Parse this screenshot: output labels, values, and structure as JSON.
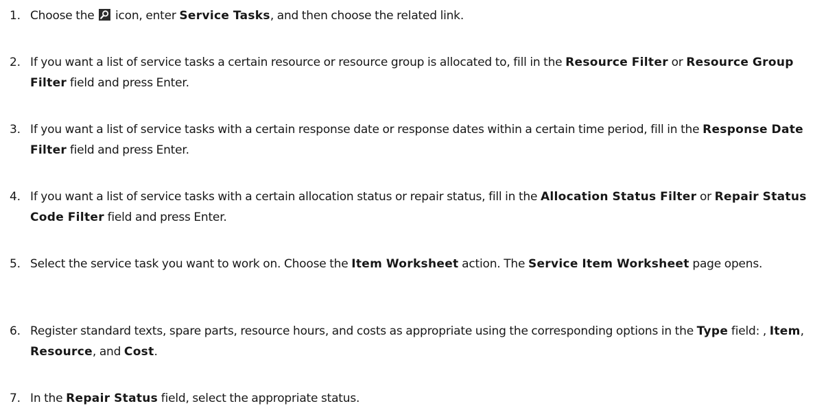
{
  "steps": [
    {
      "number": "1.",
      "parts": {
        "t1": "Choose the ",
        "t2": " icon, enter ",
        "b1": "Service Tasks",
        "t3": ", and then choose the related link."
      }
    },
    {
      "number": "2.",
      "parts": {
        "t1": "If you want a list of service tasks a certain resource or resource group is allocated to, fill in the ",
        "b1": "Resource Filter",
        "t2": " or ",
        "b2": "Resource Group Filter",
        "t3": " field and press Enter."
      }
    },
    {
      "number": "3.",
      "parts": {
        "t1": "If you want a list of service tasks with a certain response date or response dates within a certain time period, fill in the ",
        "b1": "Response Date Filter",
        "t2": " field and press Enter."
      }
    },
    {
      "number": "4.",
      "parts": {
        "t1": "If you want a list of service tasks with a certain allocation status or repair status, fill in the ",
        "b1": "Allocation Status Filter",
        "t2": " or ",
        "b2": "Repair Status Code Filter",
        "t3": " field and press Enter."
      }
    },
    {
      "number": "5.",
      "parts": {
        "t1": "Select the service task you want to work on. Choose the ",
        "b1": "Item Worksheet",
        "t2": " action. The ",
        "b2": "Service Item Worksheet",
        "t3": " page opens."
      }
    },
    {
      "number": "6.",
      "parts": {
        "t1": "Register standard texts, spare parts, resource hours, and costs as appropriate using the corresponding options in the ",
        "b1": "Type",
        "t2": " field: , ",
        "b2": "Item",
        "t3": ", ",
        "b3": "Resource",
        "t4": ", and ",
        "b4": "Cost",
        "t5": "."
      }
    },
    {
      "number": "7.",
      "parts": {
        "t1": "In the ",
        "b1": "Repair Status",
        "t2": " field, select the appropriate status."
      }
    }
  ],
  "icons": {
    "search": "search-icon"
  },
  "colors": {
    "text": "#171717",
    "icon_bg": "#2b2b2b"
  }
}
